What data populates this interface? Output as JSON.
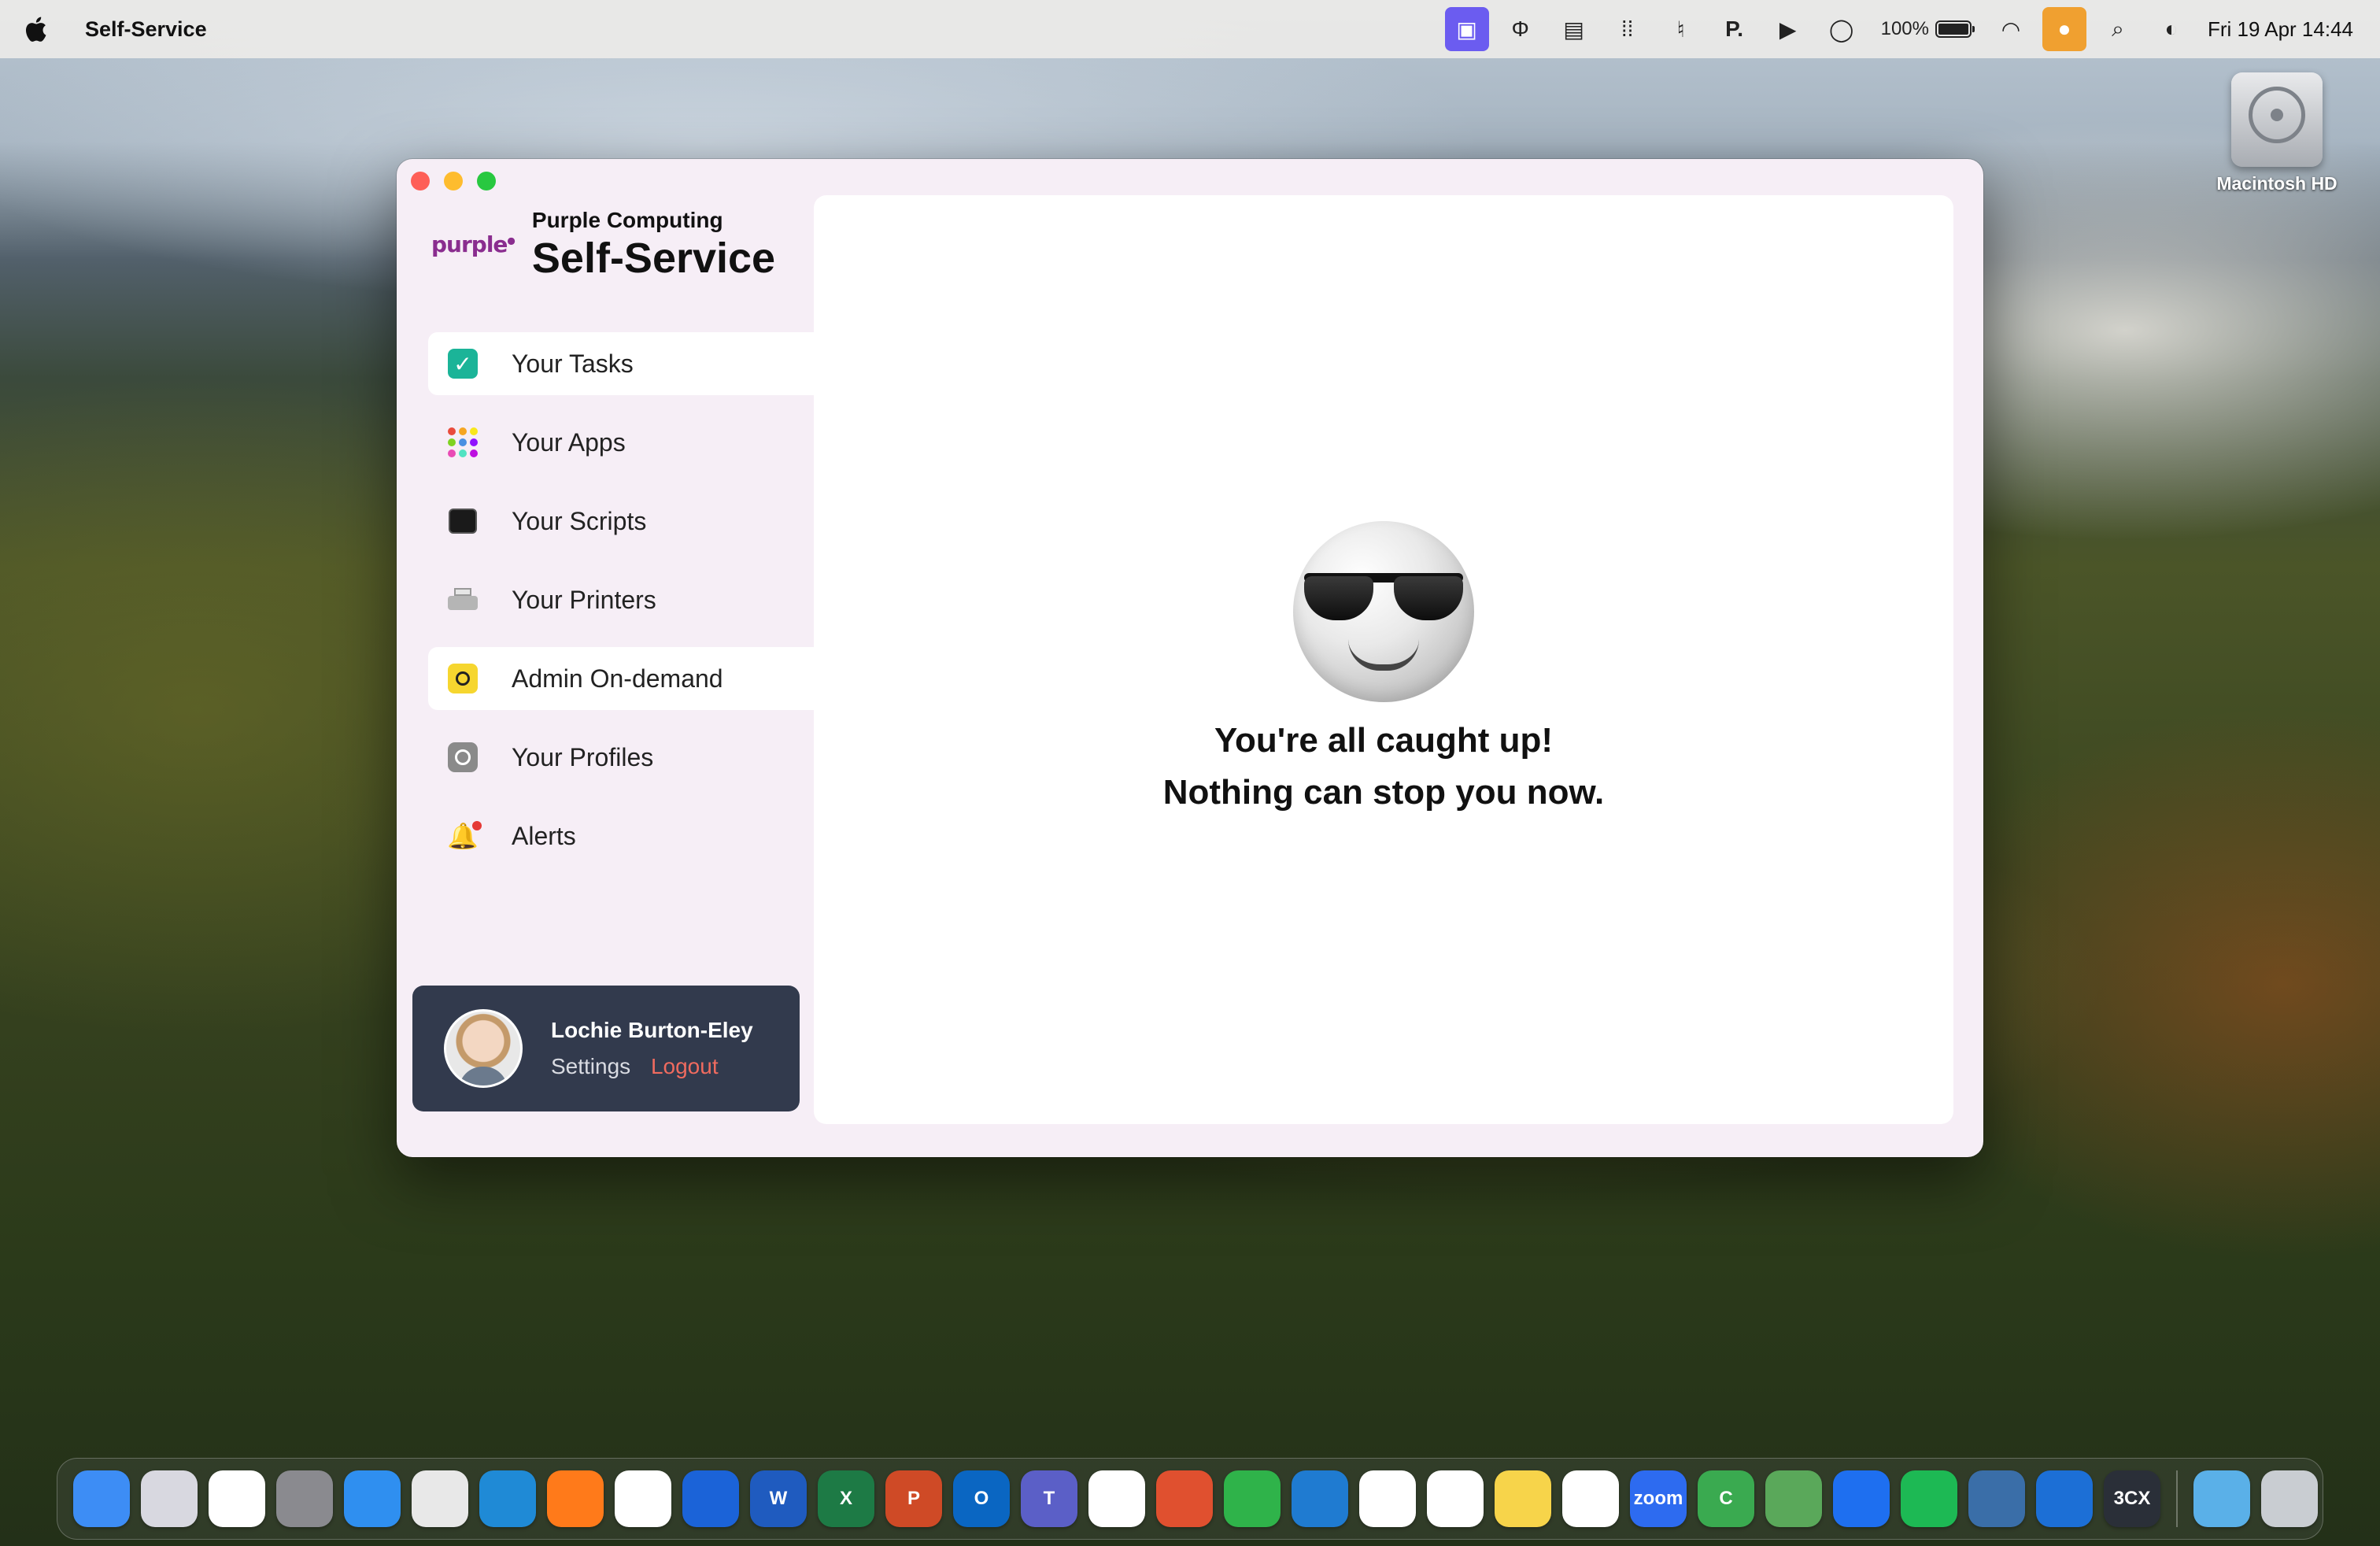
{
  "menubar": {
    "app_name": "Self-Service",
    "battery_percent": "100%",
    "battery_level": 1.0,
    "clock": "Fri 19 Apr  14:44",
    "status_icons": [
      "screen-share-icon",
      "type-icon",
      "keyboard-icon",
      "grid-dots-icon",
      "accessibility-icon",
      "p-app-icon",
      "play-icon",
      "circle-icon",
      "wifi-icon",
      "microphone-icon",
      "search-icon",
      "control-center-icon"
    ],
    "p_app_label": "P."
  },
  "desktop": {
    "hd_label": "Macintosh HD"
  },
  "window": {
    "logo_text": "purple",
    "company": "Purple Computing",
    "product": "Self-Service",
    "nav": [
      {
        "label": "Your Tasks",
        "icon": "tasks-check-icon",
        "active": true
      },
      {
        "label": "Your Apps",
        "icon": "apps-grid-icon",
        "active": false
      },
      {
        "label": "Your Scripts",
        "icon": "terminal-icon",
        "active": false
      },
      {
        "label": "Your Printers",
        "icon": "printer-icon",
        "active": false
      },
      {
        "label": "Admin On-demand",
        "icon": "admin-icon",
        "active": true
      },
      {
        "label": "Your Profiles",
        "icon": "profile-settings-icon",
        "active": false
      },
      {
        "label": "Alerts",
        "icon": "bell-icon",
        "active": false
      }
    ],
    "user": {
      "name": "Lochie Burton-Eley",
      "settings_label": "Settings",
      "logout_label": "Logout"
    },
    "main": {
      "message_line1": "You're all caught up!",
      "message_line2": "Nothing can stop you now."
    }
  },
  "colors": {
    "accent_purple": "#6b5cf0",
    "logout_red": "#f06b5f",
    "task_green": "#1bb498",
    "user_card_bg": "#323a4d",
    "brand_purple": "#8a2d8f"
  },
  "dock": {
    "apps": [
      {
        "name": "finder-icon",
        "color": "#3d8df5",
        "label": ""
      },
      {
        "name": "launchpad-icon",
        "color": "#d8d8e0",
        "label": ""
      },
      {
        "name": "app-icon",
        "color": "#ffffff",
        "label": ""
      },
      {
        "name": "system-settings-icon",
        "color": "#8a8a8f",
        "label": ""
      },
      {
        "name": "safari-icon",
        "color": "#2f8ff0",
        "label": ""
      },
      {
        "name": "chrome-icon",
        "color": "#e8e8e8",
        "label": ""
      },
      {
        "name": "edge-icon",
        "color": "#1f8ad6",
        "label": ""
      },
      {
        "name": "firefox-icon",
        "color": "#ff7a1a",
        "label": ""
      },
      {
        "name": "slack-icon",
        "color": "#ffffff",
        "label": ""
      },
      {
        "name": "1password-icon",
        "color": "#1b63d8",
        "label": ""
      },
      {
        "name": "word-icon",
        "color": "#1f5bbf",
        "label": "W"
      },
      {
        "name": "excel-icon",
        "color": "#1d7a45",
        "label": "X"
      },
      {
        "name": "powerpoint-icon",
        "color": "#cf4a26",
        "label": "P"
      },
      {
        "name": "outlook-icon",
        "color": "#0a66c2",
        "label": "O"
      },
      {
        "name": "teams-icon",
        "color": "#5b5fc7",
        "label": "T"
      },
      {
        "name": "monday-icon",
        "color": "#ffffff",
        "label": ""
      },
      {
        "name": "remote-desktop-icon",
        "color": "#e0502f",
        "label": ""
      },
      {
        "name": "numbers-icon",
        "color": "#2fb34a",
        "label": ""
      },
      {
        "name": "vscode-icon",
        "color": "#1f7bd1",
        "label": ""
      },
      {
        "name": "acrobat-icon",
        "color": "#ffffff",
        "label": ""
      },
      {
        "name": "reminders-icon",
        "color": "#ffffff",
        "label": ""
      },
      {
        "name": "notes-icon",
        "color": "#f7d44a",
        "label": ""
      },
      {
        "name": "freeform-icon",
        "color": "#ffffff",
        "label": ""
      },
      {
        "name": "zoom-icon",
        "color": "#2d6bf0",
        "label": "zoom"
      },
      {
        "name": "camtasia-icon",
        "color": "#3aaa50",
        "label": "C"
      },
      {
        "name": "maps-icon",
        "color": "#5aa85a",
        "label": ""
      },
      {
        "name": "teamviewer-icon",
        "color": "#1e6ff0",
        "label": ""
      },
      {
        "name": "spotify-icon",
        "color": "#1db954",
        "label": ""
      },
      {
        "name": "preview-icon",
        "color": "#3a6ea8",
        "label": ""
      },
      {
        "name": "xcode-icon",
        "color": "#1c6fd6",
        "label": ""
      },
      {
        "name": "3cx-icon",
        "color": "#2a2f38",
        "label": "3CX"
      }
    ],
    "folder": {
      "name": "downloads-folder-icon",
      "color": "#5ab0e8"
    },
    "trash": {
      "name": "trash-icon",
      "color": "#c9cdd2"
    }
  }
}
